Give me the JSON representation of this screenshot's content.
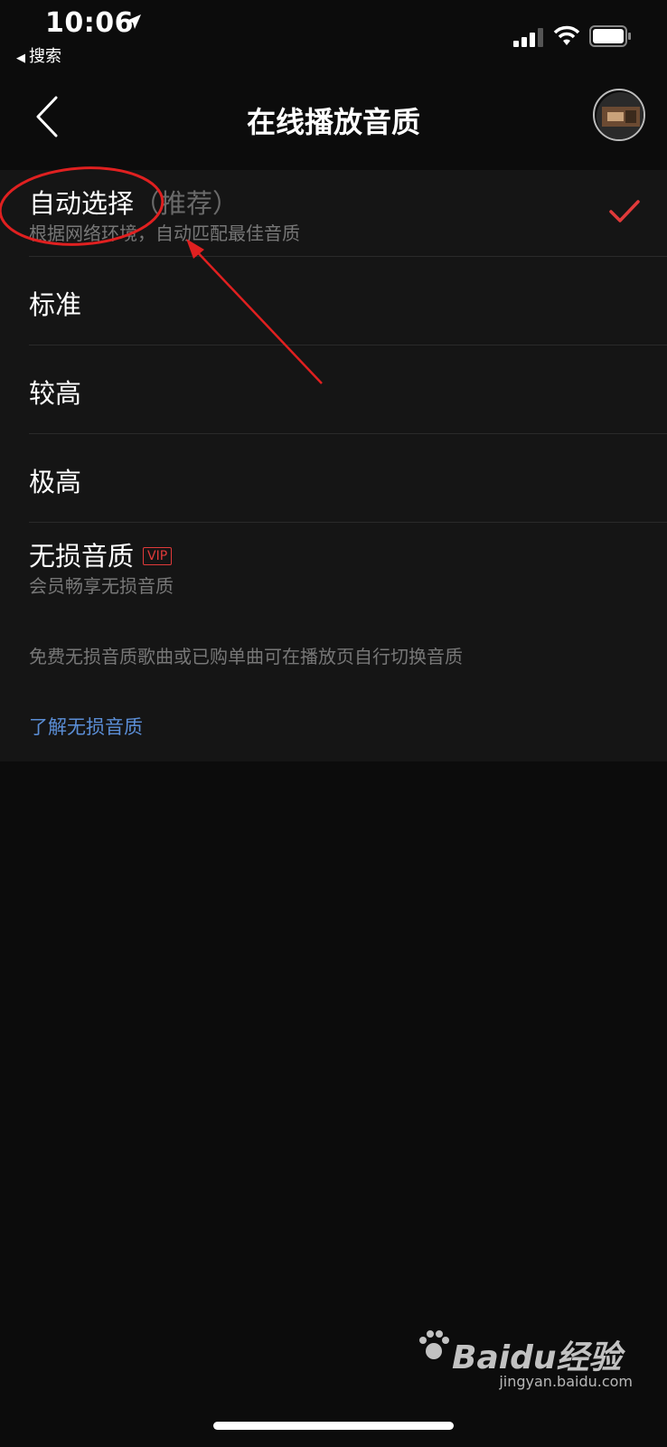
{
  "status_bar": {
    "time": "10:06",
    "back_app_label": "搜索"
  },
  "nav": {
    "title": "在线播放音质"
  },
  "options": [
    {
      "label": "自动选择",
      "recommend": "（推荐）",
      "subtitle": "根据网络环境，自动匹配最佳音质",
      "selected": true
    },
    {
      "label": "标准"
    },
    {
      "label": "较高"
    },
    {
      "label": "极高"
    },
    {
      "label": "无损音质",
      "badge": "VIP",
      "subtitle": "会员畅享无损音质"
    }
  ],
  "note": "免费无损音质歌曲或已购单曲可在播放页自行切换音质",
  "learn_link": "了解无损音质",
  "watermark": {
    "brand": "Baidu经验",
    "url": "jingyan.baidu.com"
  },
  "colors": {
    "accent_red": "#e03a3a",
    "link_blue": "#5b8ed6",
    "background": "#0c0c0c",
    "panel": "#151515"
  }
}
